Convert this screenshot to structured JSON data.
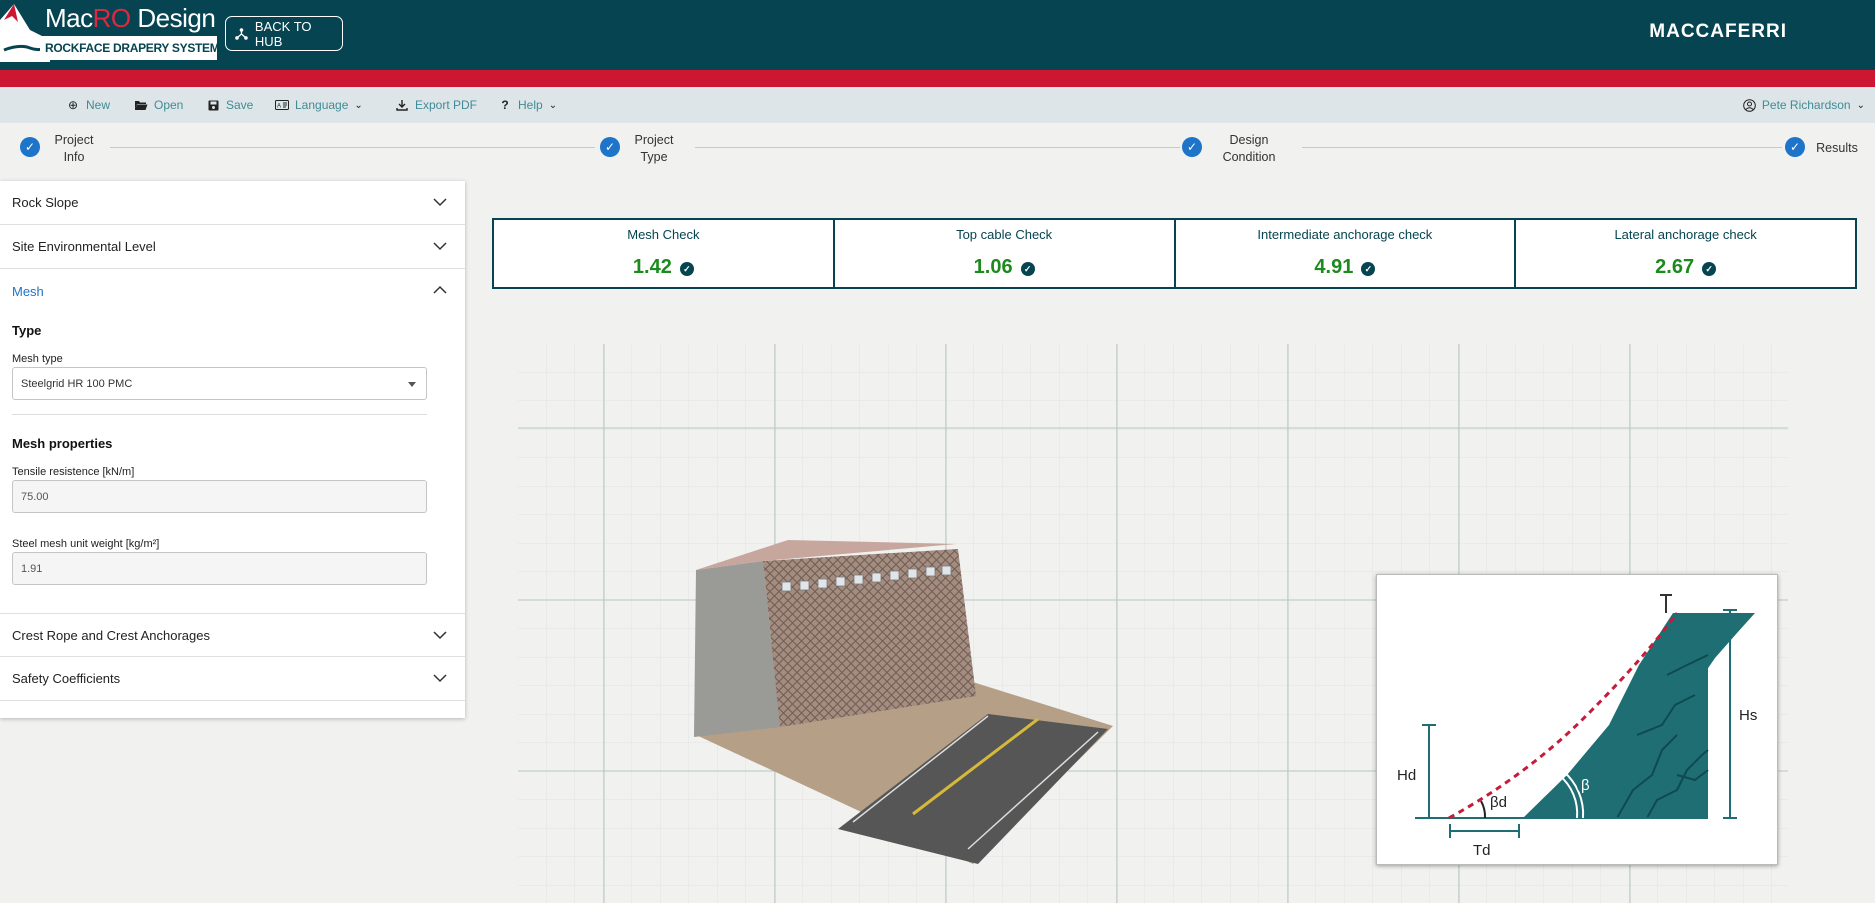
{
  "header": {
    "logo_prefix": "Mac",
    "logo_accent": "RO",
    "logo_suffix": " Design",
    "logo_subtitle": "ROCKFACE DRAPERY SYSTEMS",
    "back_button": "BACK TO HUB",
    "brand": "MACCAFERRI",
    "colors": {
      "header": "#054450",
      "accent_red": "#cc1632"
    }
  },
  "menu": {
    "new": "New",
    "open": "Open",
    "save": "Save",
    "language": "Language",
    "export_pdf": "Export PDF",
    "help": "Help",
    "user": "Pete Richardson"
  },
  "stepper": {
    "step1_line1": "Project",
    "step1_line2": "Info",
    "step2_line1": "Project",
    "step2_line2": "Type",
    "step3_line1": "Design",
    "step3_line2": "Condition",
    "step4": "Results"
  },
  "panel": {
    "rock_slope": "Rock Slope",
    "site_env": "Site Environmental Level",
    "mesh": "Mesh",
    "type_title": "Type",
    "mesh_type_label": "Mesh type",
    "mesh_type_value": "Steelgrid HR 100 PMC",
    "props_title": "Mesh properties",
    "tensile_label": "Tensile resistence [kN/m]",
    "tensile_value": "75.00",
    "weight_label": "Steel mesh unit weight [kg/m²]",
    "weight_value": "1.91",
    "crest": "Crest Rope and Crest Anchorages",
    "safety": "Safety Coefficients"
  },
  "checks": [
    {
      "title": "Mesh Check",
      "value": "1.42"
    },
    {
      "title": "Top cable Check",
      "value": "1.06"
    },
    {
      "title": "Intermediate anchorage check",
      "value": "4.91"
    },
    {
      "title": "Lateral anchorage check",
      "value": "2.67"
    }
  ],
  "diagram": {
    "hd": "Hd",
    "hs": "Hs",
    "td": "Td",
    "beta_d": "βd",
    "beta": "β"
  }
}
